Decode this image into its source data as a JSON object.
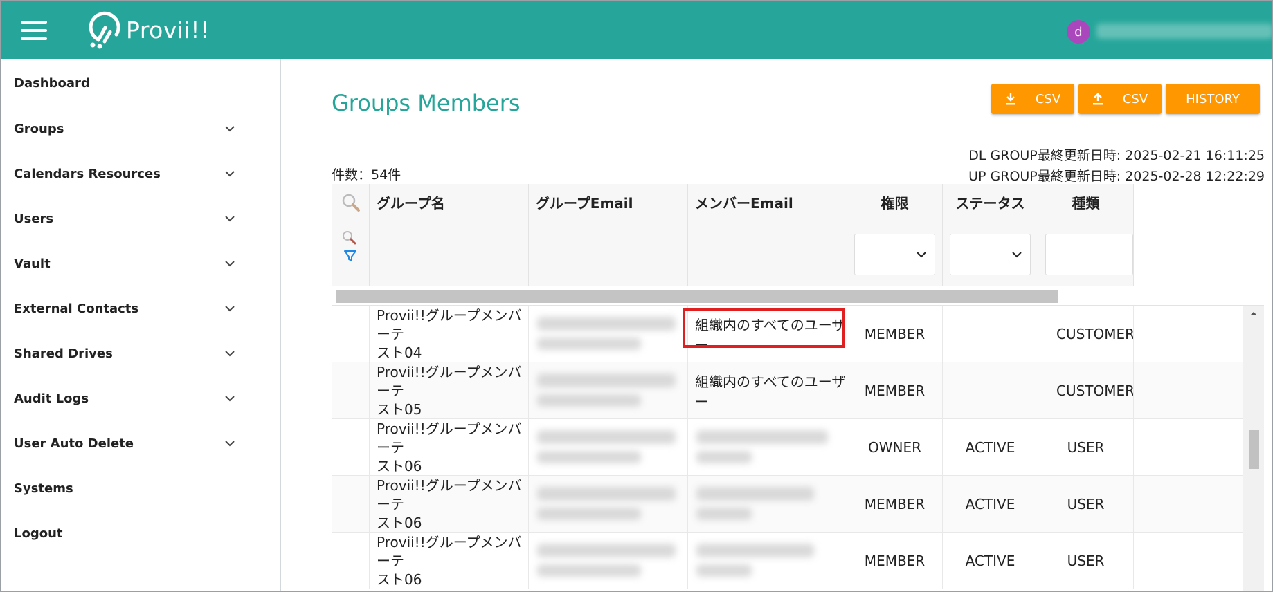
{
  "header": {
    "brand": "Provii!!",
    "avatar_initial": "d",
    "accent_color": "#26a69a"
  },
  "sidebar": {
    "items": [
      {
        "label": "Dashboard",
        "expandable": false
      },
      {
        "label": "Groups",
        "expandable": true
      },
      {
        "label": "Calendars Resources",
        "expandable": true
      },
      {
        "label": "Users",
        "expandable": true
      },
      {
        "label": "Vault",
        "expandable": true
      },
      {
        "label": "External Contacts",
        "expandable": true
      },
      {
        "label": "Shared Drives",
        "expandable": true
      },
      {
        "label": "Audit Logs",
        "expandable": true
      },
      {
        "label": "User Auto Delete",
        "expandable": true
      },
      {
        "label": "Systems",
        "expandable": false
      },
      {
        "label": "Logout",
        "expandable": false
      }
    ]
  },
  "main": {
    "title": "Groups Members",
    "buttons": {
      "download_csv": "CSV",
      "upload_csv": "CSV",
      "history": "HISTORY"
    },
    "button_color": "#ff9800",
    "count_label": "件数：54件",
    "dl_group_updated": "DL GROUP最終更新日時: 2025-02-21 16:11:25",
    "up_group_updated": "UP GROUP最終更新日時: 2025-02-28 12:22:29"
  },
  "table": {
    "columns": [
      "グループ名",
      "グループEmail",
      "メンバーEmail",
      "権限",
      "ステータス",
      "種類"
    ],
    "rows": [
      {
        "group_name": [
          "Provii!!グループメンバーテ",
          "スト04"
        ],
        "member_email": "組織内のすべてのユーザー",
        "role": "MEMBER",
        "status": "",
        "type": "CUSTOMER",
        "highlighted": true
      },
      {
        "group_name": [
          "Provii!!グループメンバーテ",
          "スト05"
        ],
        "member_email": "組織内のすべてのユーザー",
        "role": "MEMBER",
        "status": "",
        "type": "CUSTOMER",
        "highlighted": false
      },
      {
        "group_name": [
          "Provii!!グループメンバーテ",
          "スト06"
        ],
        "member_email": "",
        "role": "OWNER",
        "status": "ACTIVE",
        "type": "USER",
        "highlighted": false
      },
      {
        "group_name": [
          "Provii!!グループメンバーテ",
          "スト06"
        ],
        "member_email": "",
        "role": "MEMBER",
        "status": "ACTIVE",
        "type": "USER",
        "highlighted": false
      },
      {
        "group_name": [
          "Provii!!グループメンバーテ",
          "スト06"
        ],
        "member_email": "",
        "role": "MEMBER",
        "status": "ACTIVE",
        "type": "USER",
        "highlighted": false
      }
    ]
  }
}
